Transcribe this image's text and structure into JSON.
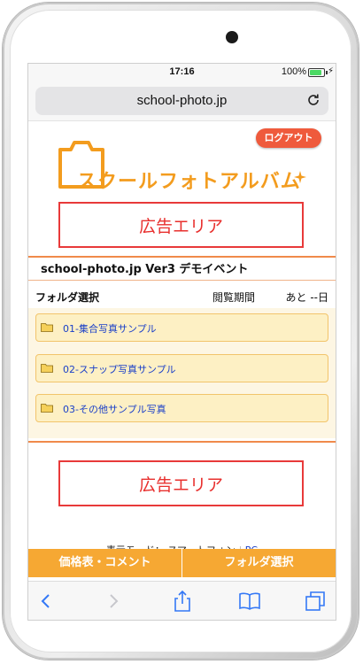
{
  "status": {
    "time": "17:16",
    "battery": "100%"
  },
  "browser": {
    "url": "school-photo.jp"
  },
  "header": {
    "logout_label": "ログアウト",
    "logo_text": "スクールフォトアルバム"
  },
  "ad": {
    "label": "広告エリア"
  },
  "event": {
    "title": "school-photo.jp Ver3 デモイベント"
  },
  "folder_header": {
    "title": "フォルダ選択",
    "period_label": "閲覧期間",
    "remaining": "あと --日"
  },
  "folders": [
    {
      "label": "01-集合写真サンプル"
    },
    {
      "label": "02-スナップ写真サンプル"
    },
    {
      "label": "03-その他サンプル写真"
    }
  ],
  "display_mode": {
    "label": "表示モード： スマートフォン",
    "separator": "|",
    "pc_link": "PC"
  },
  "bottom_tabs": {
    "price": "価格表・コメント",
    "folder": "フォルダ選択"
  },
  "colors": {
    "accent": "#f6a833",
    "ad_red": "#e8302e",
    "logout": "#ef5a3c",
    "link": "#1a3fc8"
  },
  "toolbar_icons": [
    "back-icon",
    "forward-icon",
    "share-icon",
    "bookmarks-icon",
    "tabs-icon"
  ]
}
